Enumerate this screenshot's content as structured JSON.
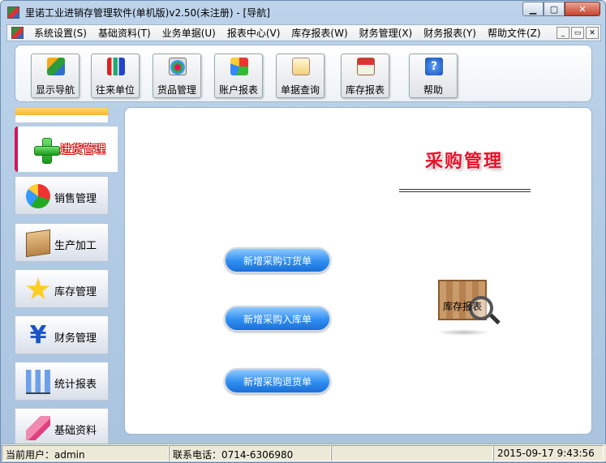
{
  "window": {
    "title": "里诺工业进销存管理软件(单机版)v2.50(未注册) - [导航]"
  },
  "menu": {
    "items": [
      "系统设置(S)",
      "基础资料(T)",
      "业务单据(U)",
      "报表中心(V)",
      "库存报表(W)",
      "财务管理(X)",
      "财务报表(Y)",
      "帮助文件(Z)"
    ]
  },
  "toolbar": {
    "items": [
      {
        "label": "显示导航",
        "icon": "navigation-icon"
      },
      {
        "label": "往来单位",
        "icon": "contacts-icon"
      },
      {
        "label": "货品管理",
        "icon": "goods-icon"
      },
      {
        "label": "账户报表",
        "icon": "account-report-icon"
      },
      {
        "label": "单据查询",
        "icon": "document-query-icon"
      },
      {
        "label": "库存报表",
        "icon": "stock-report-icon"
      },
      {
        "label": "帮助",
        "icon": "help-icon"
      }
    ]
  },
  "sidebar": {
    "active": {
      "label": "进货管理",
      "icon": "plus-icon"
    },
    "items": [
      {
        "label": "销售管理",
        "icon": "pie-chart-icon"
      },
      {
        "label": "生产加工",
        "icon": "box-icon"
      },
      {
        "label": "库存管理",
        "icon": "star-icon"
      },
      {
        "label": "财务管理",
        "icon": "yen-icon"
      },
      {
        "label": "统计报表",
        "icon": "bar-chart-icon"
      },
      {
        "label": "基础资料",
        "icon": "brush-icon"
      }
    ]
  },
  "content": {
    "title": "采购管理",
    "buttons": [
      "新增采购订货单",
      "新增采购入库单",
      "新增采购退货单"
    ],
    "stock_report_label": "库存报表",
    "help_glyph": "?",
    "yen_glyph": "¥"
  },
  "status": {
    "user": "当前用户：admin",
    "phone": "联系电话：0714-6306980",
    "datetime": "2015-09-17 9:43:56"
  },
  "colors": {
    "accent": "#d4145a",
    "title_red": "#e8102a",
    "pill_blue": "#2f8ef0"
  }
}
